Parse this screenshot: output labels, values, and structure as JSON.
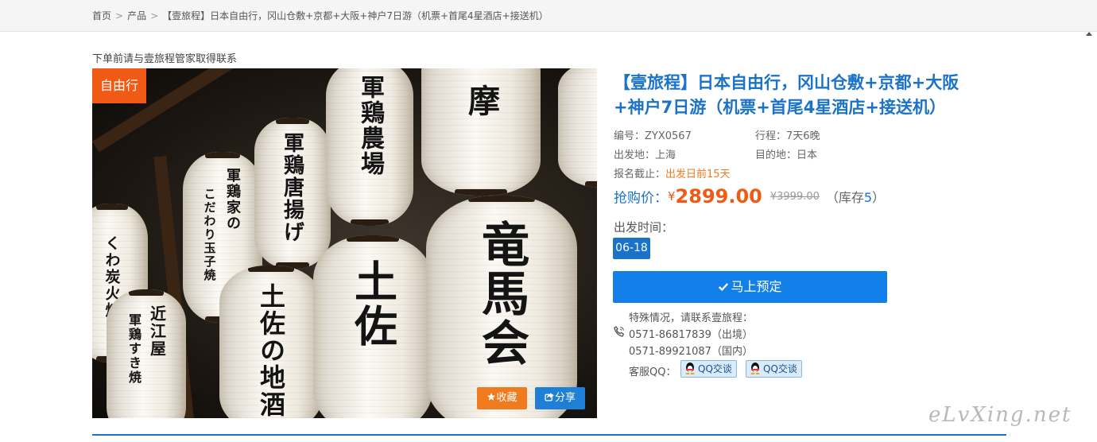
{
  "breadcrumb": {
    "items": [
      "首页",
      "产品",
      "【壹旅程】日本自由行，冈山仓敷+京都+大阪+神户7日游（机票+首尾4星酒店+接送机）"
    ],
    "separator": ">"
  },
  "notice": "下单前请与壹旅程管家取得联系",
  "photo": {
    "badge": "自由行",
    "lanterns": [
      "軍鶏家の",
      "こだわり玉子焼",
      "軍鶏唐揚げ",
      "軍鶏農場",
      "摩",
      "近江屋",
      "軍鶏すき焼",
      "土佐の地酒",
      "土佐",
      "竜馬会",
      "くわ炭火焼"
    ],
    "favorite_label": "收藏",
    "share_label": "分享"
  },
  "product": {
    "title": "【壹旅程】日本自由行，冈山仓敷+京都+大阪+神户7日游（机票+首尾4星酒店+接送机）",
    "code_label": "编号：",
    "code": "ZYX0567",
    "itinerary_label": "行程：",
    "itinerary": "7天6晚",
    "origin_label": "出发地：",
    "origin": "上海",
    "destination_label": "目的地：",
    "destination": "日本",
    "deadline_label": "报名截止：",
    "deadline": "出发日前15天",
    "price_label": "抢购价：",
    "currency": "¥",
    "price": "2899.00",
    "original_price": "¥3999.00",
    "stock_prefix": "（库存",
    "stock": "5",
    "stock_suffix": "）",
    "departure_label": "出发时间：",
    "departure_date": "06-18",
    "book_label": "马上预定"
  },
  "contact": {
    "intro": "特殊情况，请联系壹旅程：",
    "phone_intl": "0571-86817839（出境）",
    "phone_domestic": "0571-89921087（国内）",
    "qq_label": "客服QQ：",
    "qq_buttons": [
      "QQ交谈",
      "QQ交谈"
    ]
  },
  "watermark": "eLvXing.net",
  "colors": {
    "brand_blue": "#1a73c8",
    "accent_orange": "#f05a14",
    "book_button": "#137fe8"
  },
  "icons": [
    "check-icon",
    "star-icon",
    "share-icon",
    "phone-icon",
    "qq-penguin-icon"
  ]
}
